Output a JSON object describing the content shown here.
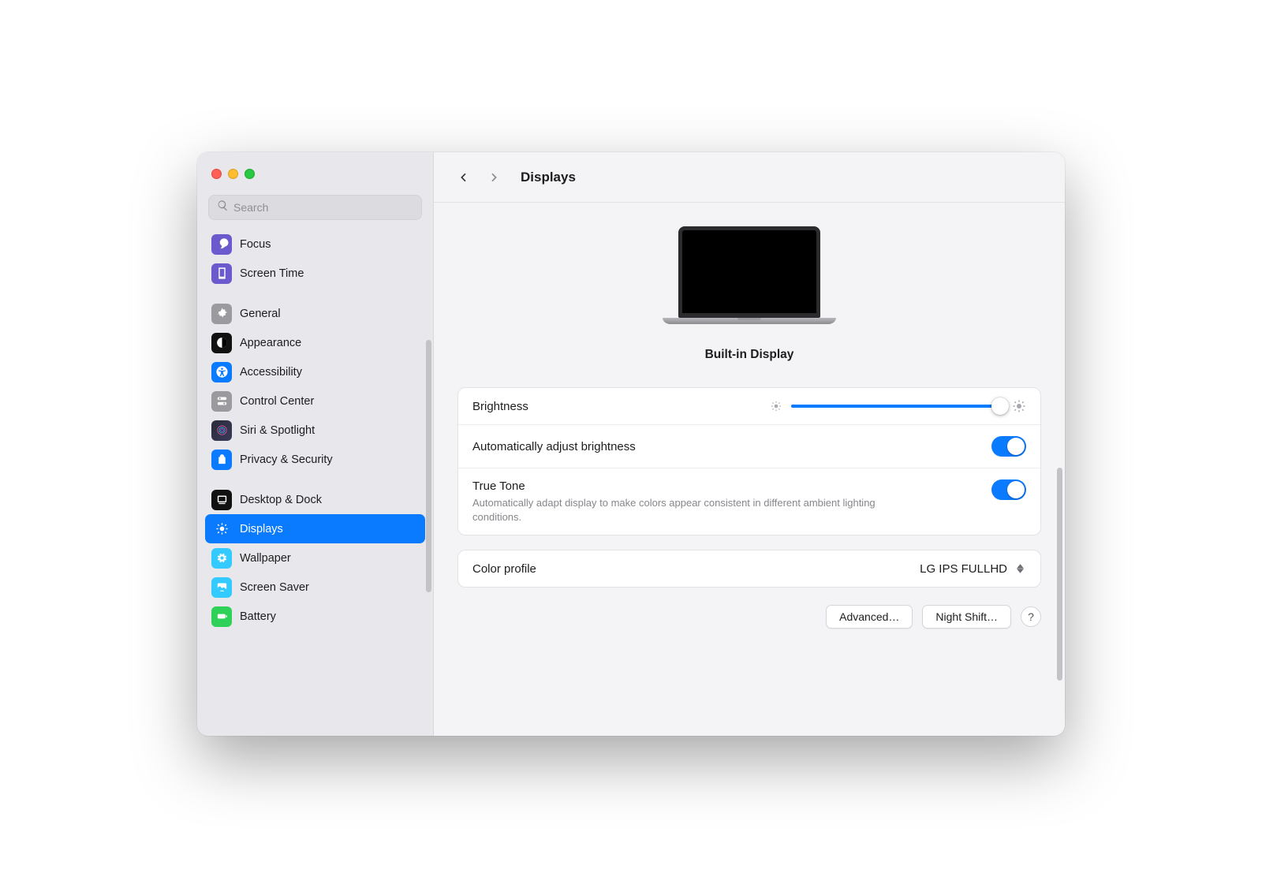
{
  "header": {
    "title": "Displays"
  },
  "search": {
    "placeholder": "Search",
    "value": ""
  },
  "sidebar": {
    "items": [
      {
        "label": "Focus",
        "icon": "focus-icon"
      },
      {
        "label": "Screen Time",
        "icon": "screentime-icon"
      },
      {
        "label": "General",
        "icon": "general-icon"
      },
      {
        "label": "Appearance",
        "icon": "appearance-icon"
      },
      {
        "label": "Accessibility",
        "icon": "accessibility-icon"
      },
      {
        "label": "Control Center",
        "icon": "control-center-icon"
      },
      {
        "label": "Siri & Spotlight",
        "icon": "siri-icon"
      },
      {
        "label": "Privacy & Security",
        "icon": "privacy-icon"
      },
      {
        "label": "Desktop & Dock",
        "icon": "desktop-icon"
      },
      {
        "label": "Displays",
        "icon": "displays-icon",
        "selected": true
      },
      {
        "label": "Wallpaper",
        "icon": "wallpaper-icon"
      },
      {
        "label": "Screen Saver",
        "icon": "screensaver-icon"
      },
      {
        "label": "Battery",
        "icon": "battery-icon"
      }
    ]
  },
  "display": {
    "name": "Built-in Display"
  },
  "settings": {
    "brightness": {
      "label": "Brightness",
      "value": 98
    },
    "auto_brightness": {
      "label": "Automatically adjust brightness",
      "on": true
    },
    "true_tone": {
      "label": "True Tone",
      "description": "Automatically adapt display to make colors appear consistent in different ambient lighting conditions.",
      "on": true
    },
    "color_profile": {
      "label": "Color profile",
      "value": "LG IPS FULLHD"
    }
  },
  "footer": {
    "advanced": "Advanced…",
    "night_shift": "Night Shift…",
    "help": "?"
  }
}
